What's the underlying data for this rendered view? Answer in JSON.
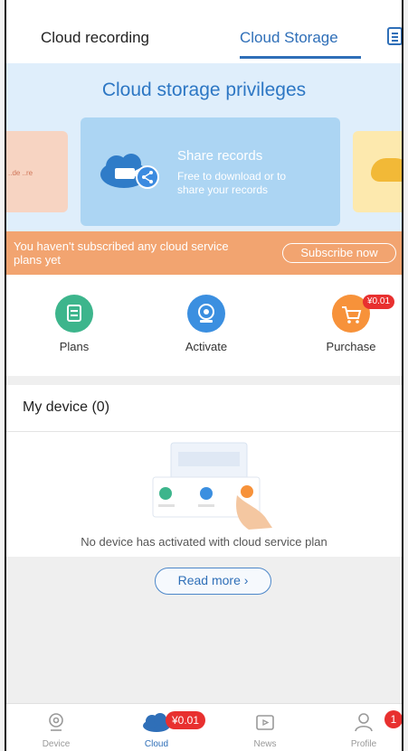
{
  "tabs": {
    "recording": "Cloud recording",
    "storage": "Cloud Storage"
  },
  "banner": {
    "title": "Cloud storage privileges",
    "card": {
      "title": "Share records",
      "desc": "Free to download or to share your records"
    },
    "left_card_text": "..de\n..re"
  },
  "notice": {
    "text": "You haven't subscribed any cloud service plans yet",
    "button": "Subscribe now"
  },
  "actions": [
    {
      "label": "Plans",
      "color": "#3db58c",
      "icon": "plans-icon"
    },
    {
      "label": "Activate",
      "color": "#3b8fe0",
      "icon": "activate-icon"
    },
    {
      "label": "Purchase",
      "color": "#f7923a",
      "icon": "cart-icon",
      "badge": "¥0.01"
    }
  ],
  "device_section": {
    "title": "My device (0)",
    "empty_text": "No device has activated with cloud service plan",
    "read_more": "Read more ›"
  },
  "bottom_nav": [
    {
      "label": "Device",
      "icon": "device-icon"
    },
    {
      "label": "Cloud",
      "icon": "cloud-icon",
      "badge": "¥0.01",
      "active": true
    },
    {
      "label": "News",
      "icon": "news-icon"
    },
    {
      "label": "Profile",
      "icon": "profile-icon",
      "badge": "1"
    }
  ],
  "colors": {
    "accent": "#2f6fb8",
    "notice": "#f2a470",
    "badge": "#e8302f"
  }
}
